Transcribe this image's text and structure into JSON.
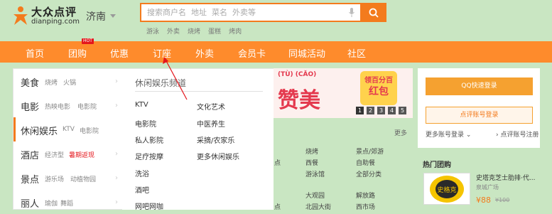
{
  "header": {
    "brand_name": "大众点评",
    "brand_domain": "dianping.com",
    "city": "济南",
    "search_placeholder": "搜索商户名  地址  菜名  外卖等",
    "hot_words": [
      "游泳",
      "外卖",
      "烧烤",
      "蛋糕",
      "烤肉"
    ]
  },
  "nav": {
    "items": [
      "首页",
      "团购",
      "优惠",
      "订座",
      "外卖",
      "会员卡",
      "同城活动",
      "社区"
    ],
    "hot_tag": "HOT"
  },
  "categories": [
    {
      "name": "美食",
      "subs": [
        "烧烤",
        "火锅"
      ],
      "highlight": false
    },
    {
      "name": "电影",
      "subs": [
        "热映电影",
        "电影院"
      ],
      "highlight": false
    },
    {
      "name": "休闲娱乐",
      "subs": [
        "KTV",
        "电影院"
      ],
      "highlight": false
    },
    {
      "name": "酒店",
      "subs": [
        "经济型",
        "暑期返现"
      ],
      "highlight": true
    },
    {
      "name": "景点",
      "subs": [
        "游乐场",
        "动植物园"
      ],
      "highlight": false
    },
    {
      "name": "丽人",
      "subs": [
        "瑜伽",
        "舞蹈"
      ],
      "highlight": false
    }
  ],
  "flyout": {
    "title": "休闲娱乐频道",
    "links": [
      [
        "KTV",
        "文化艺术"
      ],
      [
        "电影院",
        "中医养生"
      ],
      [
        "私人影院",
        "采摘/农家乐"
      ],
      [
        "足疗按摩",
        "更多休闲娱乐"
      ],
      [
        "洗浴",
        ""
      ],
      [
        "酒吧",
        ""
      ],
      [
        "网吧网咖",
        ""
      ]
    ]
  },
  "banner": {
    "pinyin": "(TÙ)  (CĂO)",
    "word": "赞美",
    "badge_top": "领百分百",
    "badge_main": "红包",
    "pages": [
      "1",
      "2",
      "3",
      "4",
      "5"
    ]
  },
  "middle": {
    "more": "更多",
    "col_a": [
      "点",
      "点"
    ],
    "col_b": [
      "烧烤",
      "西餐",
      "游泳馆",
      "大观园",
      "北园大街"
    ],
    "col_c": [
      "景点/郊游",
      "自助餐",
      "全部分类",
      "解放路",
      "西市场"
    ]
  },
  "login": {
    "qq_button": "QQ快速登录",
    "account_button": "点评账号登录",
    "more_login": "更多账号登录",
    "register": "点评账号注册"
  },
  "hot_deals": {
    "title": "热门团购",
    "thumb_text": "史格克",
    "deal_title": "史塔克芝士肋排·代...",
    "area": "泉城广场",
    "price": "¥88",
    "orig_price": "¥100"
  },
  "colors": {
    "accent": "#f37b1d",
    "nav_bg": "#fe8b2c",
    "page_bg": "#c9e6c2",
    "hot": "#e4161c"
  }
}
